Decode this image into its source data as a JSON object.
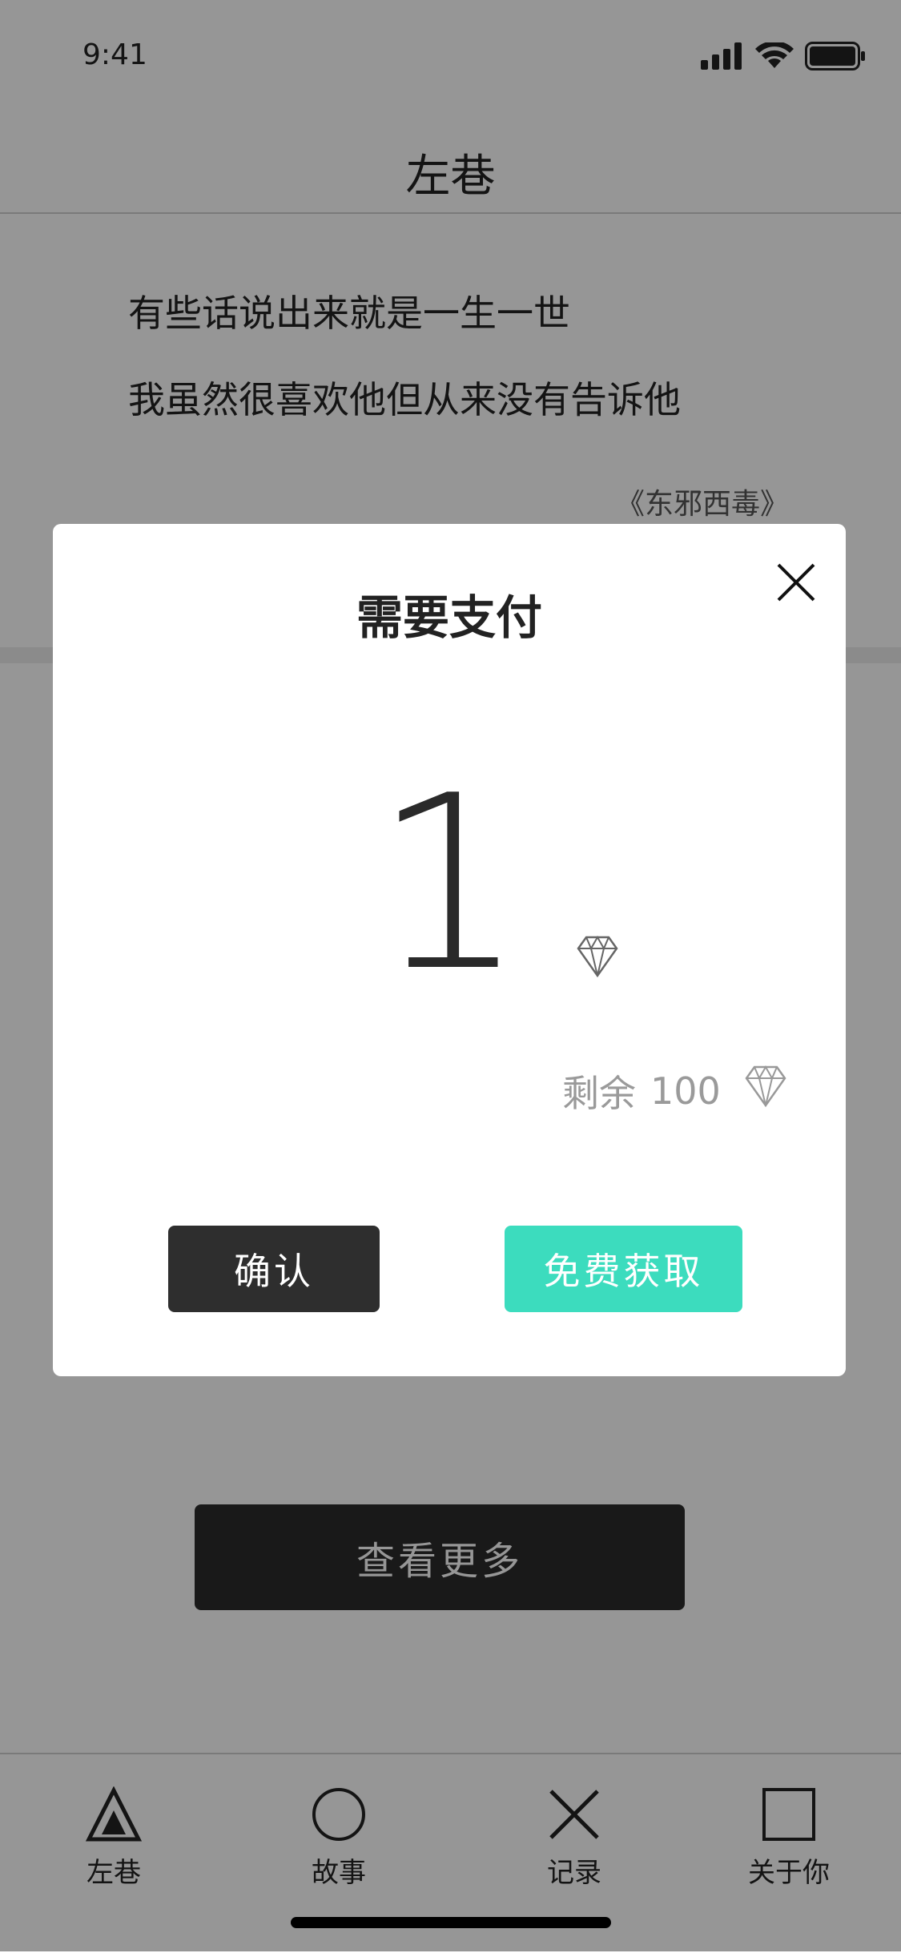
{
  "status": {
    "time": "9:41"
  },
  "nav": {
    "title": "左巷"
  },
  "quote": {
    "line1": "有些话说出来就是一生一世",
    "line2": "我虽然很喜欢他但从来没有告诉他",
    "source": "《东邪西毒》"
  },
  "more_button": "查看更多",
  "tabs": [
    {
      "label": "左巷",
      "icon": "triangle-icon"
    },
    {
      "label": "故事",
      "icon": "circle-icon"
    },
    {
      "label": "记录",
      "icon": "cross-icon"
    },
    {
      "label": "关于你",
      "icon": "square-icon"
    }
  ],
  "modal": {
    "title": "需要支付",
    "amount": "1",
    "remaining_label": "剩余",
    "remaining_value": "100",
    "confirm_label": "确认",
    "free_label": "免费获取",
    "accent_color": "#3cdcbe"
  }
}
